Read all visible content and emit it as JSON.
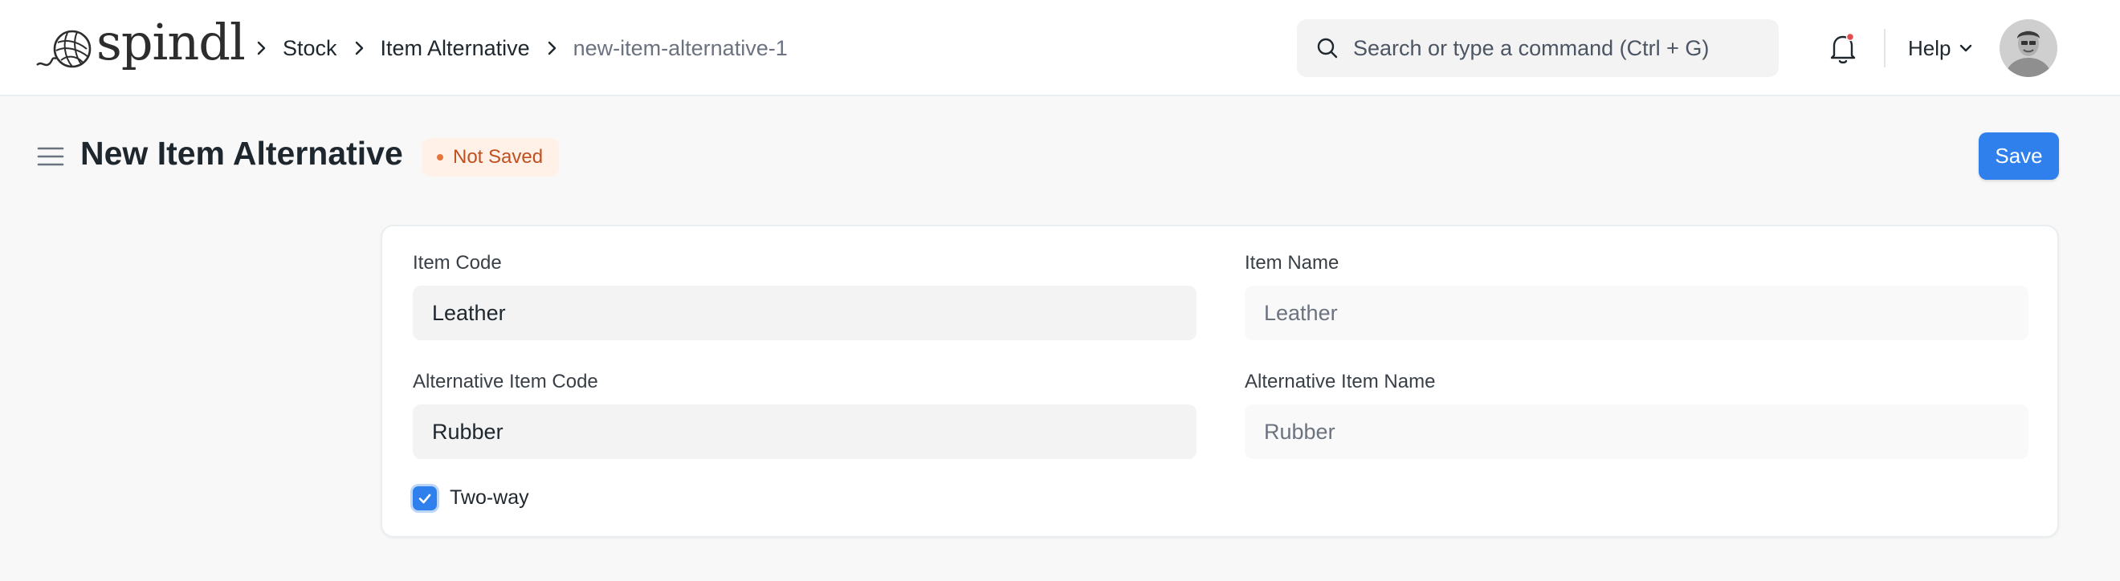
{
  "brand": {
    "name": "spindl"
  },
  "breadcrumb": {
    "items": [
      "Stock",
      "Item Alternative"
    ],
    "current": "new-item-alternative-1"
  },
  "search": {
    "placeholder": "Search or type a command (Ctrl + G)"
  },
  "header": {
    "help_label": "Help"
  },
  "page": {
    "title": "New Item Alternative",
    "status": "Not Saved",
    "save_label": "Save"
  },
  "form": {
    "item_code": {
      "label": "Item Code",
      "value": "Leather"
    },
    "item_name": {
      "label": "Item Name",
      "value": "Leather"
    },
    "alt_item_code": {
      "label": "Alternative Item Code",
      "value": "Rubber"
    },
    "alt_item_name": {
      "label": "Alternative Item Name",
      "value": "Rubber"
    },
    "two_way": {
      "label": "Two-way",
      "checked": true
    }
  },
  "colors": {
    "primary": "#2f80ed",
    "status_text": "#c0501f",
    "status_bg": "#fff1e7",
    "notification_dot": "#e24c4c"
  }
}
